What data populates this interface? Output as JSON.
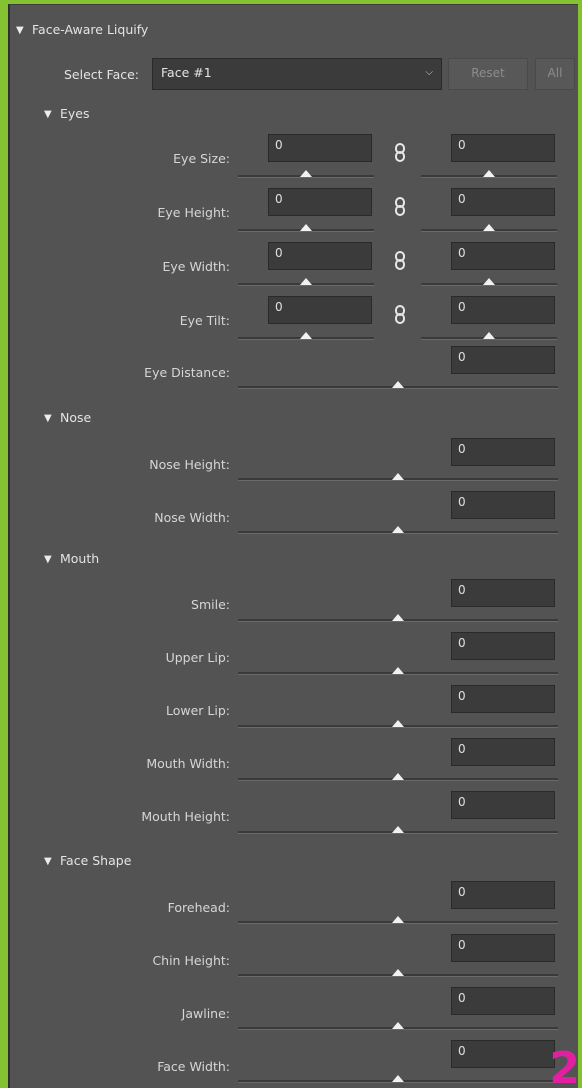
{
  "panel": {
    "title": "Face-Aware Liquify",
    "select_face_label": "Select Face:",
    "select_face_value": "Face #1",
    "reset_label": "Reset",
    "all_label": "All"
  },
  "sections": {
    "eyes": {
      "title": "Eyes",
      "eye_size": {
        "label": "Eye Size:",
        "left": "0",
        "right": "0"
      },
      "eye_height": {
        "label": "Eye Height:",
        "left": "0",
        "right": "0"
      },
      "eye_width": {
        "label": "Eye Width:",
        "left": "0",
        "right": "0"
      },
      "eye_tilt": {
        "label": "Eye Tilt:",
        "left": "0",
        "right": "0"
      },
      "eye_distance": {
        "label": "Eye Distance:",
        "value": "0"
      }
    },
    "nose": {
      "title": "Nose",
      "nose_height": {
        "label": "Nose Height:",
        "value": "0"
      },
      "nose_width": {
        "label": "Nose Width:",
        "value": "0"
      }
    },
    "mouth": {
      "title": "Mouth",
      "smile": {
        "label": "Smile:",
        "value": "0"
      },
      "upper_lip": {
        "label": "Upper Lip:",
        "value": "0"
      },
      "lower_lip": {
        "label": "Lower Lip:",
        "value": "0"
      },
      "mouth_width": {
        "label": "Mouth Width:",
        "value": "0"
      },
      "mouth_height": {
        "label": "Mouth Height:",
        "value": "0"
      }
    },
    "face_shape": {
      "title": "Face Shape",
      "forehead": {
        "label": "Forehead:",
        "value": "0"
      },
      "chin_height": {
        "label": "Chin Height:",
        "value": "0"
      },
      "jawline": {
        "label": "Jawline:",
        "value": "0"
      },
      "face_width": {
        "label": "Face Width:",
        "value": "0"
      }
    }
  },
  "overlay_badge": "2",
  "colors": {
    "frame": "#85c232",
    "panel": "#535353",
    "field": "#3b3b3b",
    "badge": "#e020a0"
  }
}
